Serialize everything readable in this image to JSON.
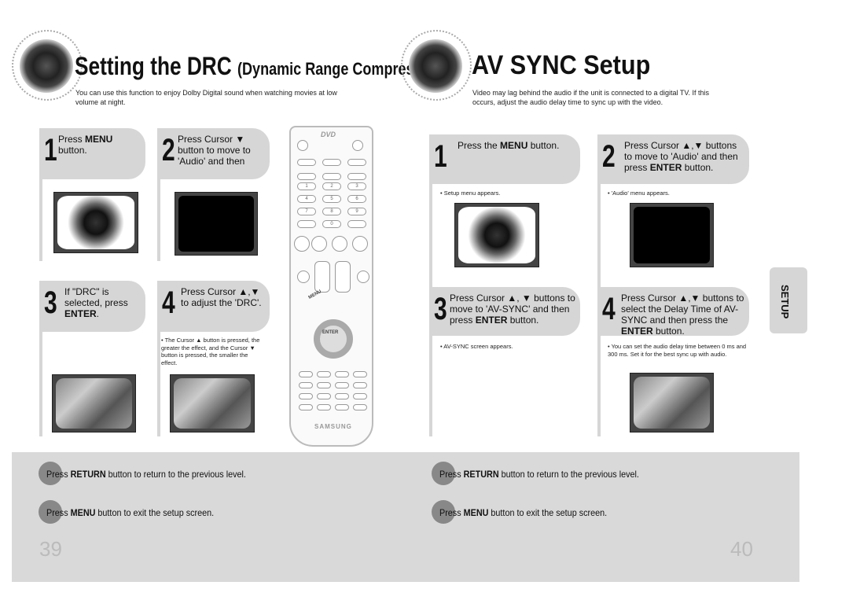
{
  "left": {
    "title_main": "Setting the DRC",
    "title_sub": "(Dynamic Range Compression)",
    "description": "You can use this function to enjoy Dolby Digital sound when watching movies at low volume at night.",
    "steps": [
      {
        "num": "1",
        "pre": "Press ",
        "bold": "MENU",
        "post": " button."
      },
      {
        "num": "2",
        "pre": "Press Cursor ▼ button to move to 'Audio' and then",
        "bold": "",
        "post": ""
      },
      {
        "num": "3",
        "pre": "If \"DRC\" is selected, press ",
        "bold": "ENTER",
        "post": "."
      },
      {
        "num": "4",
        "pre": "Press Cursor ▲,▼ to adjust the 'DRC'.",
        "bold": "",
        "post": ""
      }
    ],
    "note4": "• The Cursor ▲ button is pressed, the greater the effect, and the Cursor ▼ button is pressed, the smaller the effect."
  },
  "right": {
    "title": "AV SYNC Setup",
    "description": "Video may lag behind the audio if the unit is connected to a digital TV. If this occurs, adjust the audio delay time to sync up with the video.",
    "steps": [
      {
        "num": "1",
        "pre": "Press the ",
        "bold": "MENU",
        "post": " button."
      },
      {
        "num": "2",
        "pre": "Press Cursor ▲,▼ buttons to move to 'Audio' and then press ",
        "bold": "ENTER",
        "post": " button."
      },
      {
        "num": "3",
        "pre": "Press Cursor ▲, ▼ buttons to move to 'AV-SYNC' and then press ",
        "bold": "ENTER",
        "post": " button."
      },
      {
        "num": "4",
        "pre": "Press Cursor ▲,▼ buttons to select the Delay Time of AV-SYNC and then press the ",
        "bold": "ENTER",
        "post": " button."
      }
    ],
    "notes": [
      "• Setup menu appears.",
      "• 'Audio' menu appears.",
      "• AV-SYNC screen appears.",
      "• You can set the audio delay time between 0 ms and 300 ms. Set it for the best sync up with audio."
    ],
    "tab": "SETUP"
  },
  "remote": {
    "logo": "DVD",
    "brand": "SAMSUNG",
    "enter": "ENTER",
    "menu": "MENU",
    "numbers": [
      "1",
      "2",
      "3",
      "4",
      "5",
      "6",
      "7",
      "8",
      "9",
      "0"
    ]
  },
  "bottom": {
    "return": {
      "pre": "Press ",
      "bold": "RETURN",
      "post": " button to return to the previous level."
    },
    "menu": {
      "pre": "Press ",
      "bold": "MENU",
      "post": " button to exit the setup screen."
    },
    "page_left": "39",
    "page_right": "40"
  }
}
